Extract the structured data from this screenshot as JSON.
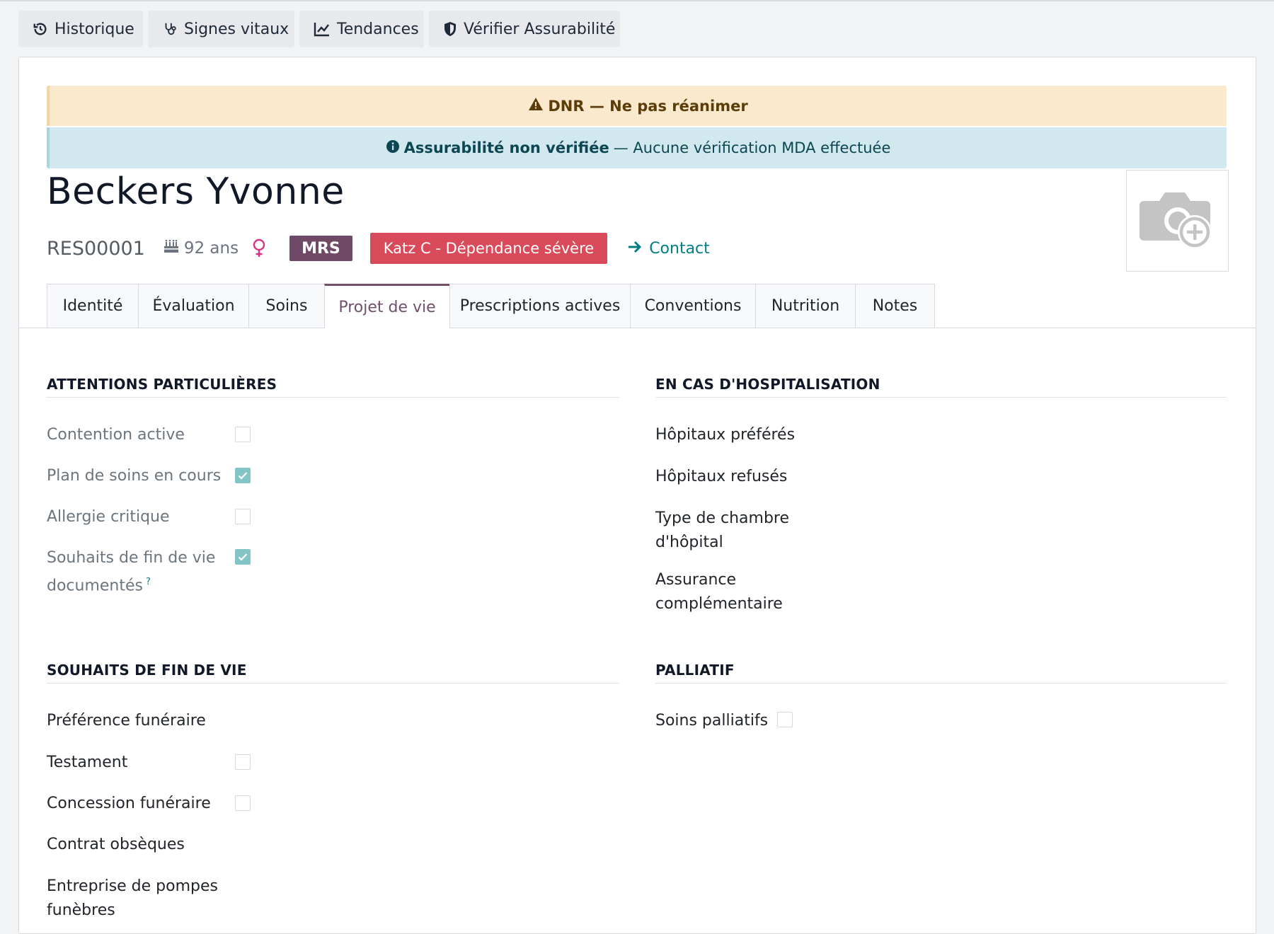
{
  "toolbar": {
    "history": "Historique",
    "vitals": "Signes vitaux",
    "trends": "Tendances",
    "verify": "Vérifier Assurabilité"
  },
  "alerts": {
    "dnr": "DNR — Ne pas réanimer",
    "insurability_strong": "Assurabilité non vérifiée",
    "insurability_rest": "— Aucune vérification MDA effectuée"
  },
  "resident": {
    "name": "Beckers Yvonne",
    "ref": "RES00001",
    "age": "92 ans",
    "badge_type": "MRS",
    "badge_katz": "Katz C - Dépendance sévère",
    "contact_label": "Contact"
  },
  "tabs": [
    "Identité",
    "Évaluation",
    "Soins",
    "Projet de vie",
    "Prescriptions actives",
    "Conventions",
    "Nutrition",
    "Notes"
  ],
  "attentions": {
    "title": "ATTENTIONS PARTICULIÈRES",
    "fields": [
      {
        "label": "Contention active",
        "checked": false
      },
      {
        "label": "Plan de soins en cours",
        "checked": true
      },
      {
        "label": "Allergie critique",
        "checked": false
      },
      {
        "label": "Souhaits de fin de vie documentés",
        "checked": true
      }
    ]
  },
  "hospital": {
    "title": "EN CAS D'HOSPITALISATION",
    "fields": [
      "Hôpitaux préférés",
      "Hôpitaux refusés",
      "Type de chambre d'hôpital",
      "Assurance complémentaire"
    ]
  },
  "endoflife": {
    "title": "SOUHAITS DE FIN DE VIE",
    "fields": [
      {
        "label": "Préférence funéraire"
      },
      {
        "label": "Testament",
        "checked": false
      },
      {
        "label": "Concession funéraire",
        "checked": false
      },
      {
        "label": "Contrat obsèques"
      },
      {
        "label": "Entreprise de pompes funèbres"
      }
    ]
  },
  "palliative": {
    "title": "PALLIATIF",
    "field": "Soins palliatifs",
    "checked": false
  },
  "colors": {
    "accent": "#71506b",
    "link": "#017e84",
    "danger": "#d94a5a",
    "checkbox_checked": "#83c5c6"
  }
}
